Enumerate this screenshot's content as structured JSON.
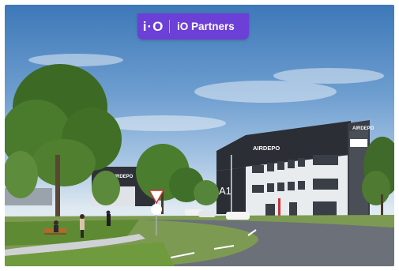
{
  "badge": {
    "logo": "i·O",
    "name": "iO Partners",
    "color": "#6c3fd6"
  },
  "building_main": {
    "name": "AIRDEPO",
    "unit": "A1"
  },
  "building_rear": {
    "name": "AIRDEPO"
  },
  "totem": {
    "name": "AIRDEPO"
  },
  "colors": {
    "sky_top": "#3d78b8",
    "facade_dark": "#2b2e34",
    "facade_light": "#e9ecef",
    "grass": "#5f8a34",
    "road": "#6b7079"
  }
}
